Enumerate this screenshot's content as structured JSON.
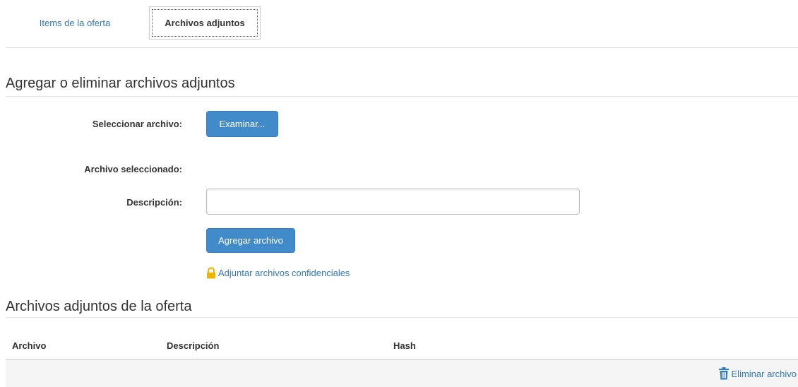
{
  "tabs": [
    {
      "label": "Items de la oferta",
      "active": false
    },
    {
      "label": "Archivos adjuntos",
      "active": true
    }
  ],
  "upload_section": {
    "title": "Agregar o eliminar archivos adjuntos",
    "select_label": "Seleccionar archivo:",
    "browse_button": "Examinar...",
    "selected_label": "Archivo seleccionado:",
    "selected_value": "",
    "description_label": "Descripción:",
    "description_value": "",
    "add_button": "Agregar archivo",
    "confidential_link": "Adjuntar archivos confidenciales"
  },
  "attachments_section": {
    "title": "Archivos adjuntos de la oferta",
    "columns": [
      "Archivo",
      "Descripción",
      "Hash"
    ],
    "delete_link": "Eliminar archivo"
  },
  "icons": {
    "confidential": "lock-icon",
    "delete": "trash-icon"
  },
  "colors": {
    "primary": "#428bca",
    "link": "#337ab7",
    "lock": "#f0b400"
  }
}
